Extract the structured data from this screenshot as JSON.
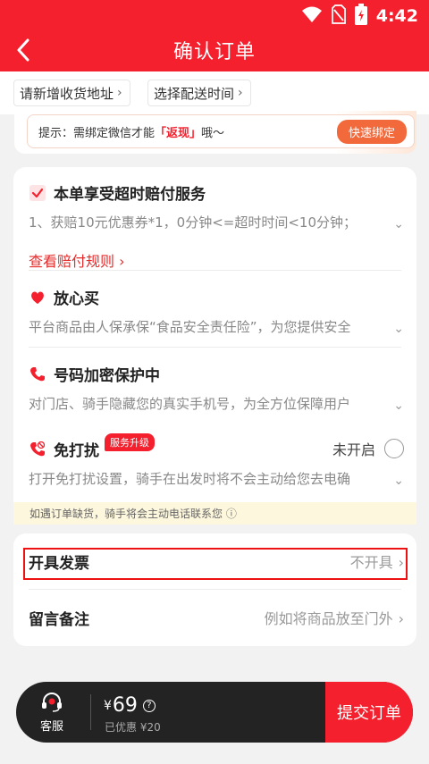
{
  "status_bar": {
    "time": "4:42"
  },
  "nav": {
    "title": "确认订单"
  },
  "chips": [
    {
      "label": "请新增收货地址"
    },
    {
      "label": "选择配送时间"
    }
  ],
  "notice": {
    "prefix": "提示：需绑定微信才能",
    "highlight": "「返现」",
    "suffix": "哦～",
    "button": "快速绑定"
  },
  "services": {
    "overtime": {
      "title": "本单享受超时赔付服务",
      "desc": "1、获赔10元优惠券*1，0分钟<=超时时间<10分钟；",
      "link": "查看赔付规则 ›"
    },
    "safe_buy": {
      "title": "放心买",
      "desc": "平台商品由人保承保“食品安全责任险”，为您提供安全"
    },
    "privacy": {
      "title": "号码加密保护中",
      "desc": "对门店、骑手隐藏您的真实手机号，为全方位保障用户"
    },
    "no_disturb": {
      "title": "免打扰",
      "badge": "服务升级",
      "status": "未开启",
      "desc": "打开免打扰设置，骑手在出发时将不会主动给您去电确"
    },
    "oos_note": "如遇订单缺货，骑手将会主动电话联系您 ⓘ"
  },
  "form": {
    "invoice": {
      "label": "开具发票",
      "value": "不开具"
    },
    "remark": {
      "label": "留言备注",
      "placeholder": "例如将商品放至门外"
    }
  },
  "bottom_bar": {
    "service_label": "客服",
    "currency": "¥",
    "price": "69",
    "discount": "已优惠 ¥20",
    "submit": "提交订单"
  },
  "colors": {
    "brand": "#f5202e",
    "accent_orange": "#f26a3c",
    "annotation_box": "#ee1111"
  }
}
